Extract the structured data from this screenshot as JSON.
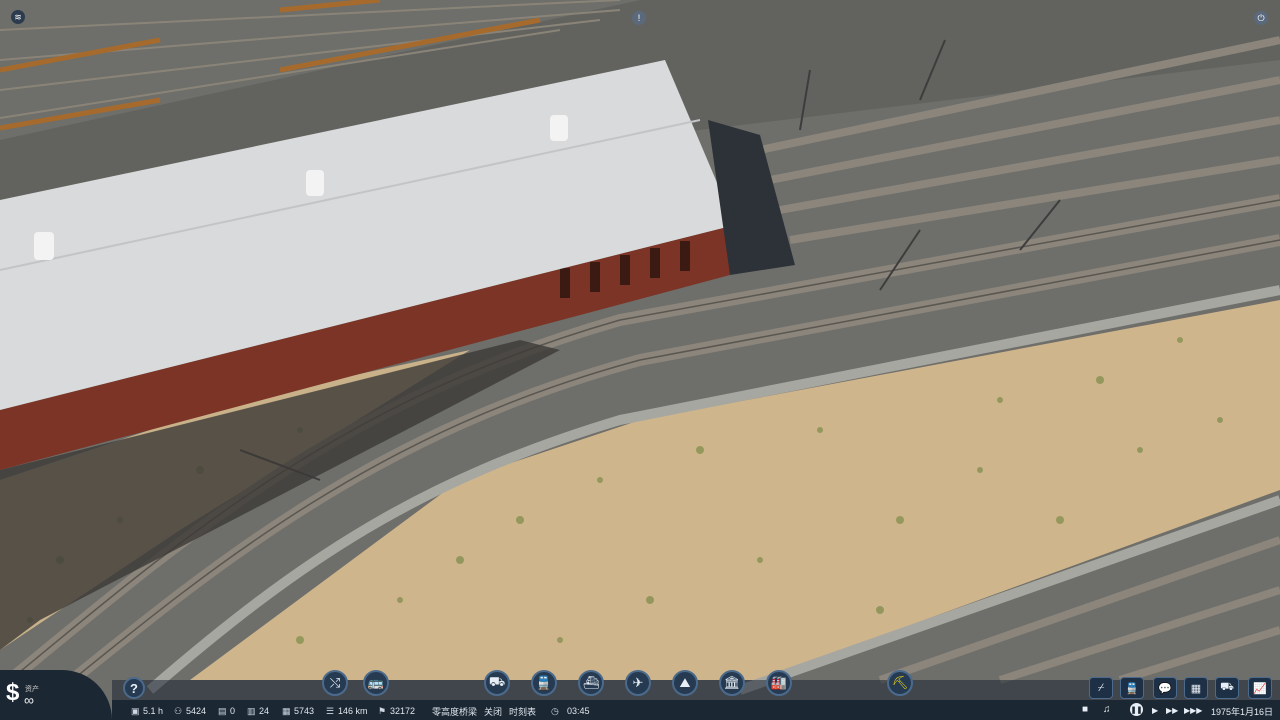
{
  "scene": {
    "description_name": "rail-yard-view"
  },
  "hud": {
    "money": {
      "symbol": "$",
      "label": "资产",
      "value": "∞"
    },
    "help_button": "?",
    "center_buttons": [
      {
        "name": "route-shuffle-button",
        "glyph": "⤭"
      },
      {
        "name": "bus-manager-button",
        "glyph": "🚌"
      }
    ],
    "build_buttons": [
      {
        "name": "road-vehicles-button",
        "glyph": "⛟"
      },
      {
        "name": "train-button",
        "glyph": "🚆"
      },
      {
        "name": "ship-button",
        "glyph": "⛴"
      },
      {
        "name": "airplane-button",
        "glyph": "✈"
      },
      {
        "name": "terrain-button",
        "glyph": "⛰"
      },
      {
        "name": "town-button",
        "glyph": "🏛"
      },
      {
        "name": "industry-button",
        "glyph": "🏭"
      }
    ],
    "bulldozer_button": "⛏",
    "right_buttons": [
      {
        "name": "lines-button",
        "glyph": "⌿"
      },
      {
        "name": "vehicles-list-button",
        "glyph": "🚆"
      },
      {
        "name": "messages-button",
        "glyph": "💬"
      },
      {
        "name": "statistics-button",
        "glyph": "▦"
      },
      {
        "name": "finances-button",
        "glyph": "⛟"
      },
      {
        "name": "charts-button",
        "glyph": "📈"
      }
    ],
    "stats": {
      "hours": "5.1 h",
      "population": "5424",
      "stat_3": "0",
      "stat_4": "24",
      "stat_5": "5743",
      "track_length": "146 km",
      "stat_7": "32172",
      "bridge_label": "零高度桥梁",
      "bridge_state": "关闭",
      "timetable": "时刻表",
      "clock": "03:45"
    },
    "controls": {
      "camera": "■",
      "music": "♫",
      "pause": "❚❚",
      "play": "▶",
      "fast": "▶▶",
      "fastest": "▶▶▶",
      "date": "1975年1月16日"
    }
  },
  "top_icons": {
    "layers": "≋",
    "alert": "!",
    "power": "⏻"
  }
}
